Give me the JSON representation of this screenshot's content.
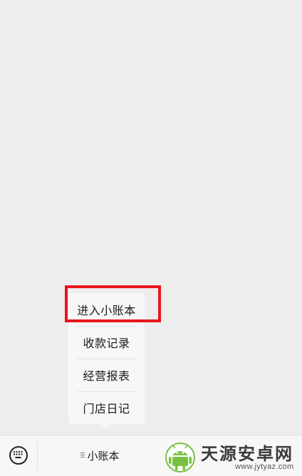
{
  "popup_menu": {
    "items": [
      {
        "label": "进入小账本"
      },
      {
        "label": "收款记录"
      },
      {
        "label": "经营报表"
      },
      {
        "label": "门店日记"
      }
    ]
  },
  "bottom_bar": {
    "keyboard_icon": "keyboard-icon",
    "menu_tab": {
      "label": "小账本",
      "icon": "menu-lines-icon"
    }
  },
  "watermark": {
    "title": "天源安卓网",
    "url": "www.jytyaz.com",
    "logo_icon": "android-logo-icon"
  },
  "colors": {
    "background": "#ededed",
    "highlight": "#e8141c",
    "logo_green": "#79c142"
  }
}
